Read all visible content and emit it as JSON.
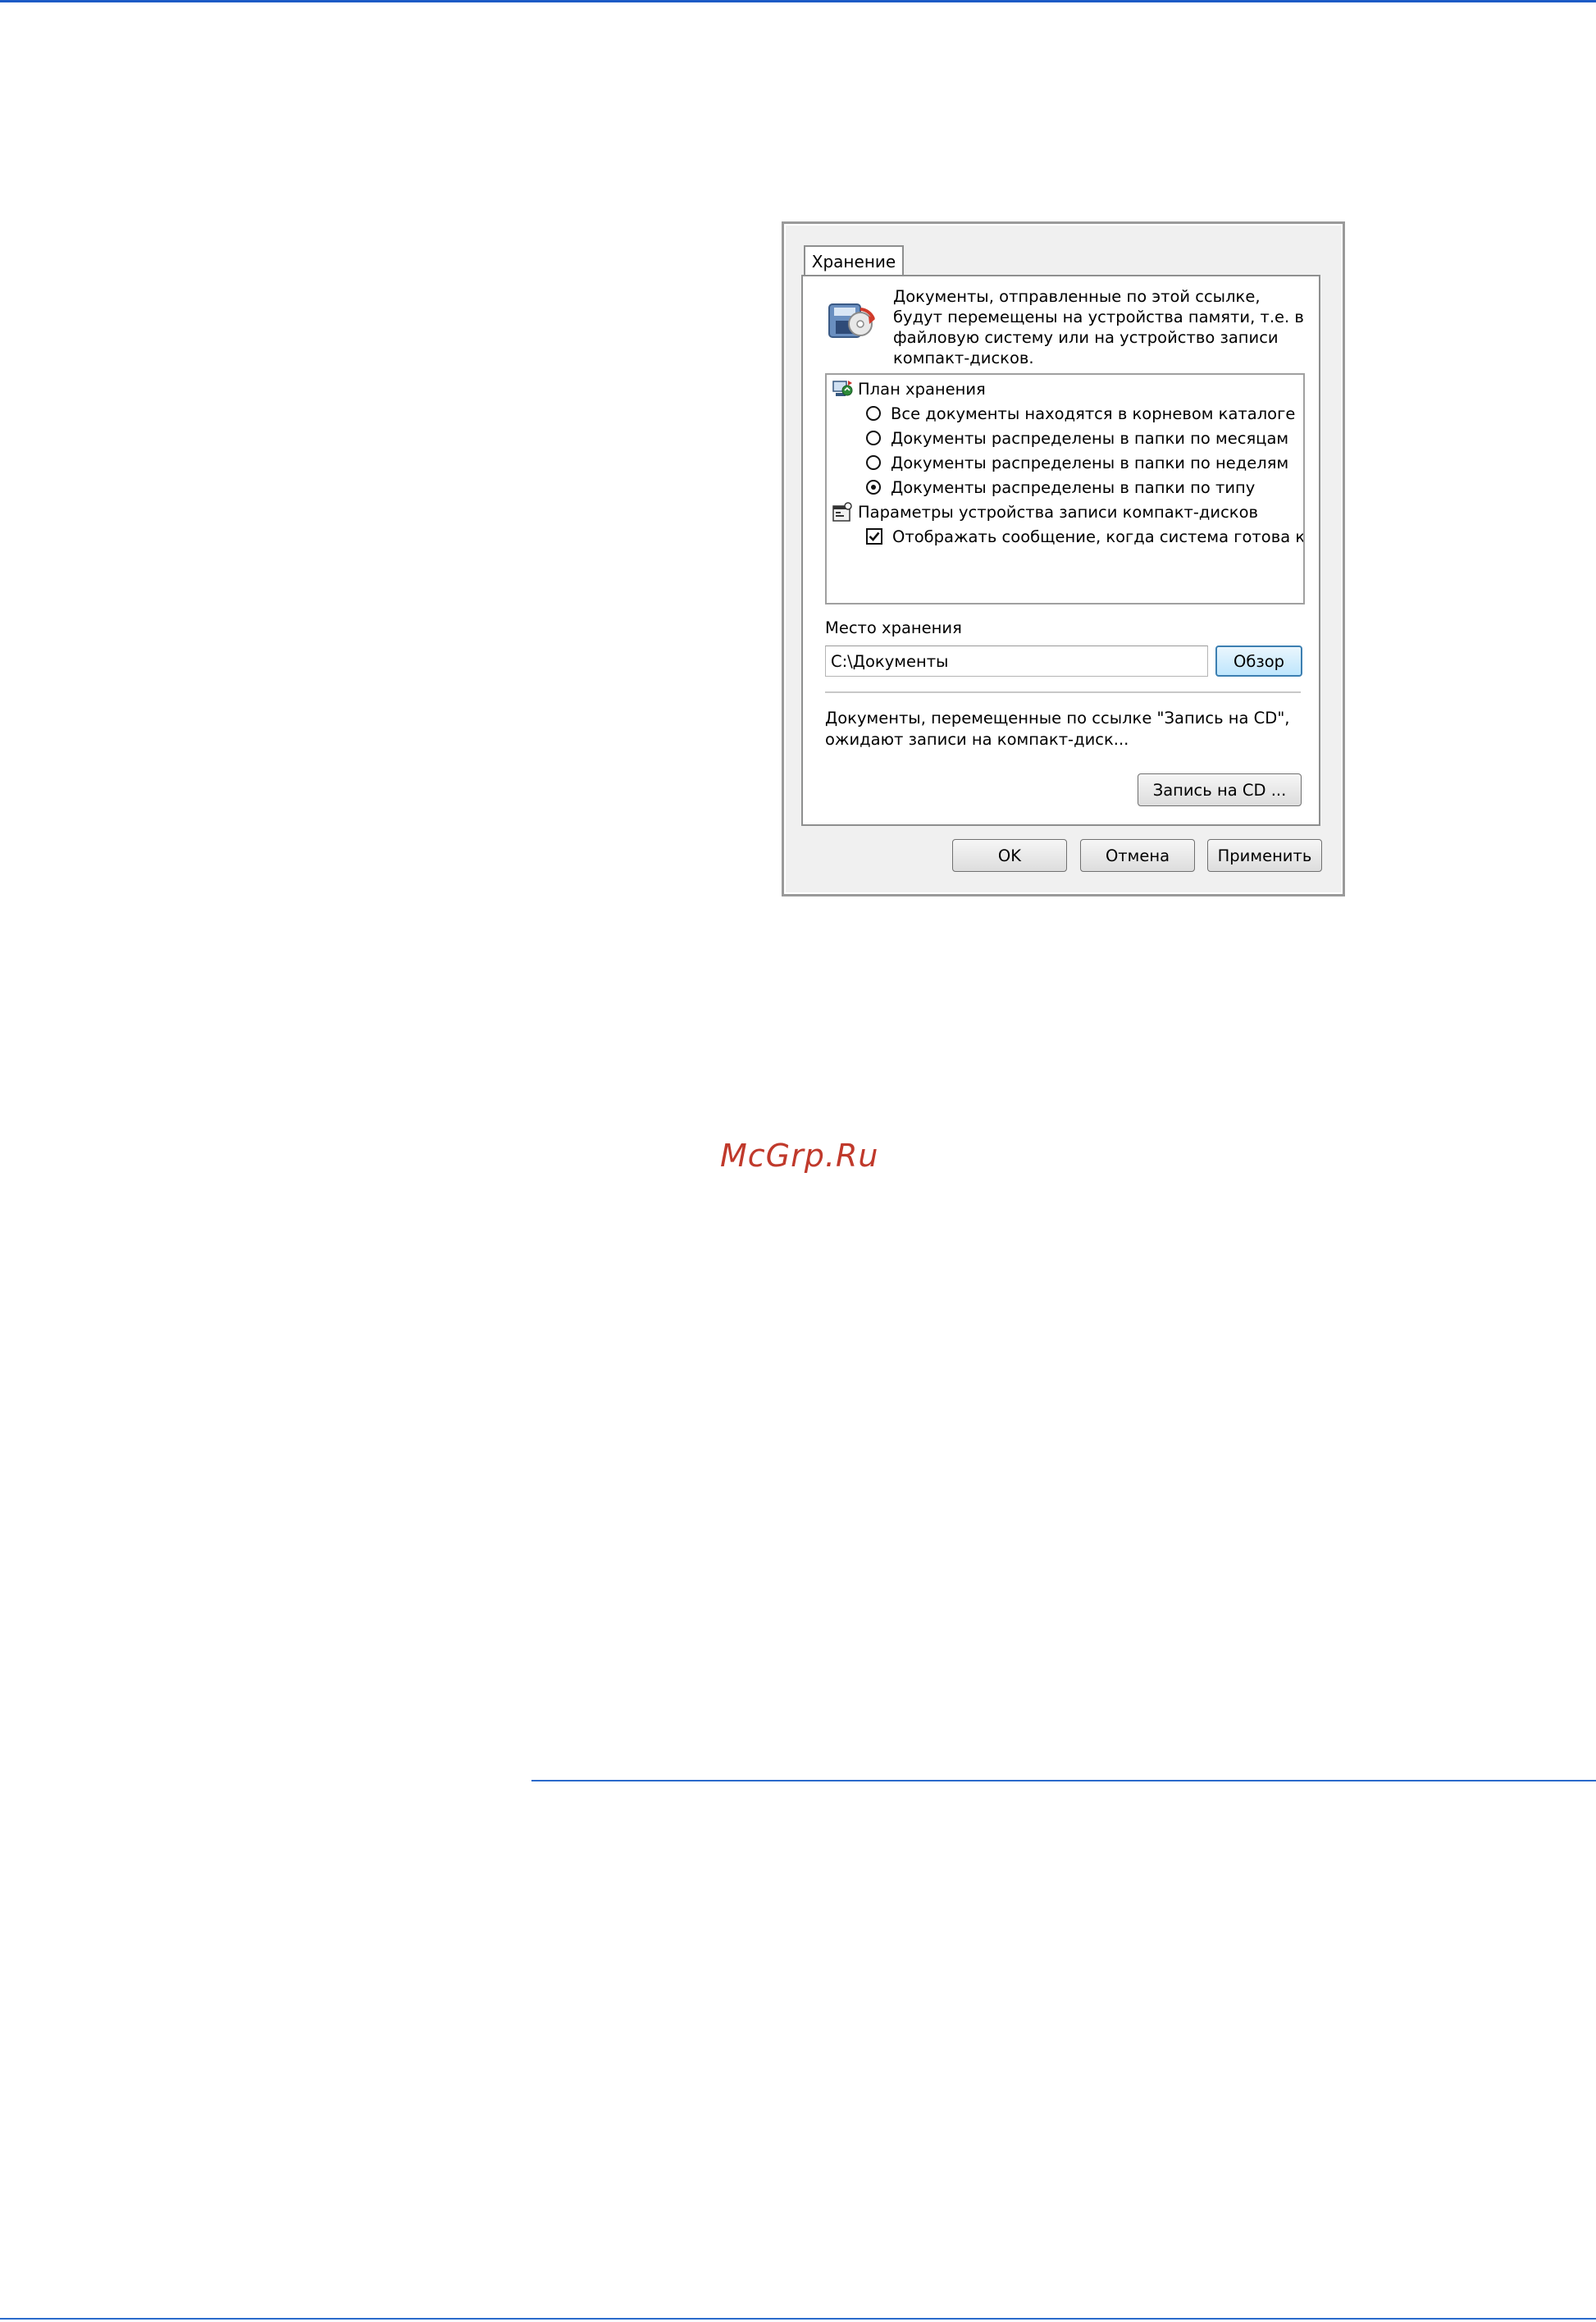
{
  "page": {
    "watermark": "McGrp.Ru"
  },
  "dialog": {
    "tab_label": "Хранение",
    "intro_text": "Документы, отправленные по этой ссылке, будут перемещены на устройства памяти, т.е. в файловую систему или на устройство записи компакт-дисков.",
    "plan_group_label": "План хранения",
    "plan_options": [
      {
        "label": "Все документы находятся в корневом каталоге",
        "checked": false
      },
      {
        "label": "Документы распределены в папки по месяцам",
        "checked": false
      },
      {
        "label": "Документы распределены в папки по неделям",
        "checked": false
      },
      {
        "label": "Документы распределены в папки по типу",
        "checked": true
      }
    ],
    "cd_group_label": "Параметры устройства записи компакт-дисков",
    "cd_option": {
      "label": "Отображать сообщение, когда система готова к з",
      "checked": true
    },
    "location_label": "Место хранения",
    "location_value": "C:\\Документы",
    "browse_label": "Обзор",
    "cd_text": "Документы, перемещенные по ссылке \"Запись на CD\", ожидают записи на компакт-диск...",
    "burn_cd_label": "Запись на CD ...",
    "ok_label": "OK",
    "cancel_label": "Отмена",
    "apply_label": "Применить"
  },
  "icons": [
    "storage-device-icon",
    "storage-plan-icon",
    "cd-settings-icon",
    "checkmark-icon"
  ],
  "colors": {
    "rule": "#2a6acb",
    "watermark": "#c0392b",
    "focus_border": "#3c7fb1"
  }
}
